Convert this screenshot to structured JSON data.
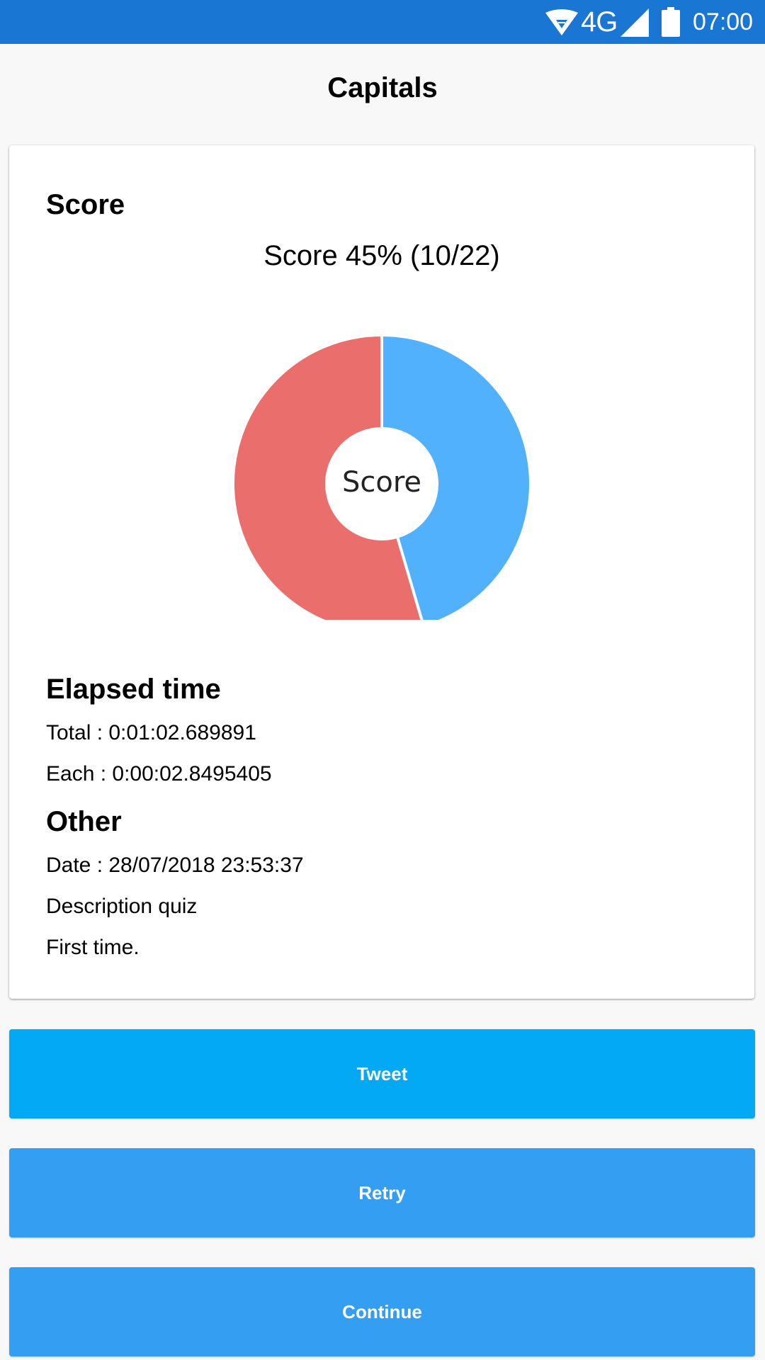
{
  "status_bar": {
    "network": "4G",
    "time": "07:00",
    "icons": [
      "wifi-icon",
      "signal-icon",
      "battery-icon"
    ]
  },
  "page": {
    "title": "Capitals"
  },
  "score_section": {
    "heading": "Score",
    "summary": "Score 45% (10/22)",
    "chart_center_label": "Score"
  },
  "chart_data": {
    "type": "pie",
    "donut": true,
    "center_label": "Score",
    "slices": [
      {
        "value": 10,
        "color": "#52b1fd"
      },
      {
        "value": 12,
        "color": "#ea6f6c"
      }
    ]
  },
  "elapsed_section": {
    "heading": "Elapsed time",
    "total": "Total : 0:01:02.689891",
    "each": "Each : 0:00:02.8495405"
  },
  "other_section": {
    "heading": "Other",
    "date": "Date : 28/07/2018 23:53:37",
    "description": "Description quiz",
    "note": "First time."
  },
  "buttons": {
    "tweet": "Tweet",
    "retry": "Retry",
    "continue": "Continue"
  },
  "colors": {
    "status_bar": "#1976d2",
    "tweet_button": "#03a9f4",
    "action_button": "#339ef2",
    "correct": "#52b1fd",
    "incorrect": "#ea6f6c"
  }
}
